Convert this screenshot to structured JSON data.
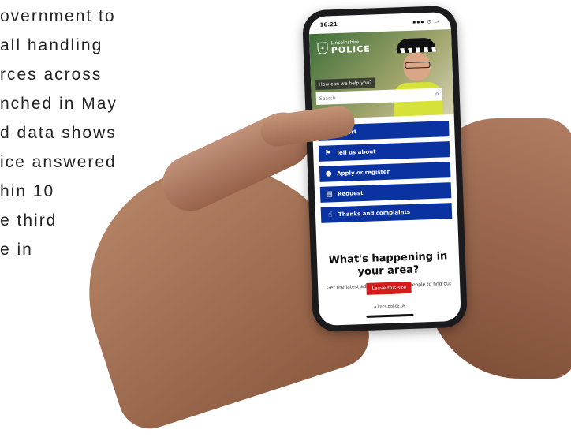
{
  "background_text": [
    "overnment to",
    "all handling",
    "rces across",
    "nched in May",
    "d data shows",
    "ice answered",
    "hin 10",
    "e third",
    "e in"
  ],
  "phone": {
    "status": {
      "time": "16:21",
      "icons": "▪▪▪ ◔ ▭"
    },
    "header": {
      "brand_small": "Lincolnshire",
      "brand_big": "POLICE",
      "help_label": "How can we help you?",
      "search_placeholder": "Search"
    },
    "menu": [
      {
        "label": "Report",
        "icon": "report-icon"
      },
      {
        "label": "Tell us about",
        "icon": "flag-icon"
      },
      {
        "label": "Apply or register",
        "icon": "bulb-icon"
      },
      {
        "label": "Request",
        "icon": "request-icon"
      },
      {
        "label": "Thanks and complaints",
        "icon": "thumbs-icon"
      }
    ],
    "section": {
      "title": "What's happening in your area?",
      "text": "Get the latest advice, help us with people to find out what",
      "leave_button": "Leave this site"
    },
    "url": "a.lincs.police.uk"
  },
  "colors": {
    "menu_blue": "#0a32a0",
    "leave_red": "#d41e1e"
  }
}
